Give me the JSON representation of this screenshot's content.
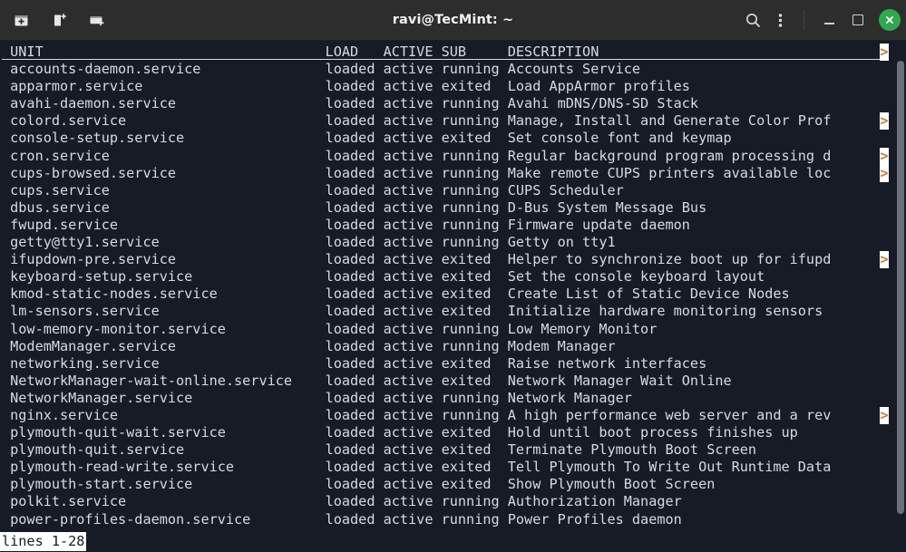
{
  "window": {
    "title": "ravi@TecMint: ~",
    "titlebar_bg": "#2d2d2d",
    "terminal_bg": "#171b25",
    "terminal_fg": "#d6dae0",
    "close_button_color": "#2fa84f",
    "truncate_marker_color": "#c8793a"
  },
  "titlebar": {
    "left_buttons": [
      {
        "name": "new-tab-icon",
        "label": "New Tab"
      },
      {
        "name": "new-window-icon",
        "label": "New Window"
      },
      {
        "name": "new-terminal-icon",
        "label": "New Terminal"
      }
    ],
    "right_buttons": [
      {
        "name": "search-icon",
        "label": "Search"
      },
      {
        "name": "menu-icon",
        "label": "Menu"
      }
    ],
    "window_controls": [
      {
        "name": "minimize-button",
        "label": "Minimize"
      },
      {
        "name": "maximize-button",
        "label": "Maximize"
      },
      {
        "name": "close-button",
        "label": "Close"
      }
    ]
  },
  "terminal": {
    "columns": {
      "unit": "UNIT",
      "load": "LOAD",
      "active": "ACTIVE",
      "sub": "SUB",
      "description": "DESCRIPTION"
    },
    "header_truncated": true,
    "truncate_glyph": ">",
    "rows": [
      {
        "unit": "accounts-daemon.service",
        "load": "loaded",
        "active": "active",
        "sub": "running",
        "description": "Accounts Service",
        "truncated": false
      },
      {
        "unit": "apparmor.service",
        "load": "loaded",
        "active": "active",
        "sub": "exited",
        "description": "Load AppArmor profiles",
        "truncated": false
      },
      {
        "unit": "avahi-daemon.service",
        "load": "loaded",
        "active": "active",
        "sub": "running",
        "description": "Avahi mDNS/DNS-SD Stack",
        "truncated": false
      },
      {
        "unit": "colord.service",
        "load": "loaded",
        "active": "active",
        "sub": "running",
        "description": "Manage, Install and Generate Color Prof",
        "truncated": true
      },
      {
        "unit": "console-setup.service",
        "load": "loaded",
        "active": "active",
        "sub": "exited",
        "description": "Set console font and keymap",
        "truncated": false
      },
      {
        "unit": "cron.service",
        "load": "loaded",
        "active": "active",
        "sub": "running",
        "description": "Regular background program processing d",
        "truncated": true
      },
      {
        "unit": "cups-browsed.service",
        "load": "loaded",
        "active": "active",
        "sub": "running",
        "description": "Make remote CUPS printers available loc",
        "truncated": true
      },
      {
        "unit": "cups.service",
        "load": "loaded",
        "active": "active",
        "sub": "running",
        "description": "CUPS Scheduler",
        "truncated": false
      },
      {
        "unit": "dbus.service",
        "load": "loaded",
        "active": "active",
        "sub": "running",
        "description": "D-Bus System Message Bus",
        "truncated": false
      },
      {
        "unit": "fwupd.service",
        "load": "loaded",
        "active": "active",
        "sub": "running",
        "description": "Firmware update daemon",
        "truncated": false
      },
      {
        "unit": "getty@tty1.service",
        "load": "loaded",
        "active": "active",
        "sub": "running",
        "description": "Getty on tty1",
        "truncated": false
      },
      {
        "unit": "ifupdown-pre.service",
        "load": "loaded",
        "active": "active",
        "sub": "exited",
        "description": "Helper to synchronize boot up for ifupd",
        "truncated": true
      },
      {
        "unit": "keyboard-setup.service",
        "load": "loaded",
        "active": "active",
        "sub": "exited",
        "description": "Set the console keyboard layout",
        "truncated": false
      },
      {
        "unit": "kmod-static-nodes.service",
        "load": "loaded",
        "active": "active",
        "sub": "exited",
        "description": "Create List of Static Device Nodes",
        "truncated": false
      },
      {
        "unit": "lm-sensors.service",
        "load": "loaded",
        "active": "active",
        "sub": "exited",
        "description": "Initialize hardware monitoring sensors",
        "truncated": false
      },
      {
        "unit": "low-memory-monitor.service",
        "load": "loaded",
        "active": "active",
        "sub": "running",
        "description": "Low Memory Monitor",
        "truncated": false
      },
      {
        "unit": "ModemManager.service",
        "load": "loaded",
        "active": "active",
        "sub": "running",
        "description": "Modem Manager",
        "truncated": false
      },
      {
        "unit": "networking.service",
        "load": "loaded",
        "active": "active",
        "sub": "exited",
        "description": "Raise network interfaces",
        "truncated": false
      },
      {
        "unit": "NetworkManager-wait-online.service",
        "load": "loaded",
        "active": "active",
        "sub": "exited",
        "description": "Network Manager Wait Online",
        "truncated": false
      },
      {
        "unit": "NetworkManager.service",
        "load": "loaded",
        "active": "active",
        "sub": "running",
        "description": "Network Manager",
        "truncated": false
      },
      {
        "unit": "nginx.service",
        "load": "loaded",
        "active": "active",
        "sub": "running",
        "description": "A high performance web server and a rev",
        "truncated": true
      },
      {
        "unit": "plymouth-quit-wait.service",
        "load": "loaded",
        "active": "active",
        "sub": "exited",
        "description": "Hold until boot process finishes up",
        "truncated": false
      },
      {
        "unit": "plymouth-quit.service",
        "load": "loaded",
        "active": "active",
        "sub": "exited",
        "description": "Terminate Plymouth Boot Screen",
        "truncated": false
      },
      {
        "unit": "plymouth-read-write.service",
        "load": "loaded",
        "active": "active",
        "sub": "exited",
        "description": "Tell Plymouth To Write Out Runtime Data",
        "truncated": false
      },
      {
        "unit": "plymouth-start.service",
        "load": "loaded",
        "active": "active",
        "sub": "exited",
        "description": "Show Plymouth Boot Screen",
        "truncated": false
      },
      {
        "unit": "polkit.service",
        "load": "loaded",
        "active": "active",
        "sub": "running",
        "description": "Authorization Manager",
        "truncated": false
      },
      {
        "unit": "power-profiles-daemon.service",
        "load": "loaded",
        "active": "active",
        "sub": "running",
        "description": "Power Profiles daemon",
        "truncated": false
      }
    ],
    "status_line": "lines 1-28"
  }
}
